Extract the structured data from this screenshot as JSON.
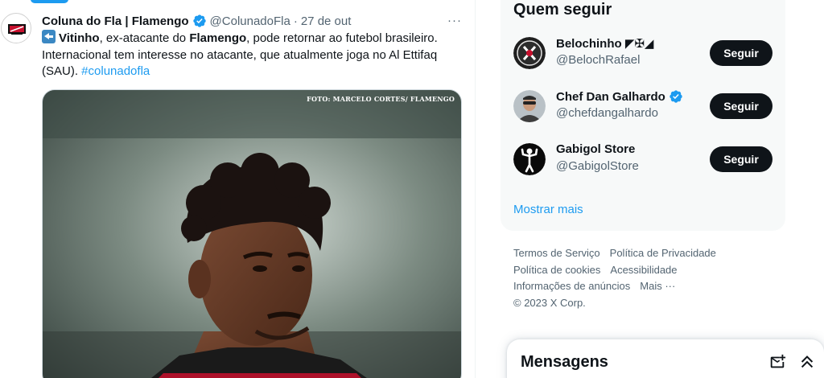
{
  "tweet": {
    "author_name": "Coluna do Fla | Flamengo",
    "handle": "@ColunadoFla",
    "separator": "·",
    "time": "27 de out",
    "more_label": "···",
    "body": {
      "line1_bold_name": "Vitinho",
      "line1_mid": ", ex-atacante do ",
      "line1_bold_club": "Flamengo",
      "line1_end": ", pode retornar ao futebol brasileiro.",
      "line2": "Internacional tem interesse no atacante, que atualmente joga no Al Ettifaq",
      "line3": "(SAU). ",
      "hashtag": "#colunadofla"
    },
    "photo_credit": "FOTO: MARCELO CORTES/ FLAMENGO"
  },
  "who_to_follow": {
    "title": "Quem seguir",
    "items": [
      {
        "name": "Belochinho ◤✠◢",
        "handle": "@BelochRafael",
        "button": "Seguir",
        "verified": false
      },
      {
        "name": "Chef Dan Galhardo",
        "handle": "@chefdangalhardo",
        "button": "Seguir",
        "verified": true
      },
      {
        "name": "Gabigol Store",
        "handle": "@GabigolStore",
        "button": "Seguir",
        "verified": false
      }
    ],
    "show_more": "Mostrar mais"
  },
  "footer": {
    "links": [
      "Termos de Serviço",
      "Política de Privacidade",
      "Política de cookies",
      "Acessibilidade",
      "Informações de anúncios",
      "Mais ···"
    ],
    "copyright": "© 2023 X Corp."
  },
  "messages": {
    "title": "Mensagens"
  },
  "colors": {
    "accent": "#1d9bf0",
    "text_primary": "#0f1419",
    "text_secondary": "#536471",
    "button_bg": "#0f1419"
  }
}
